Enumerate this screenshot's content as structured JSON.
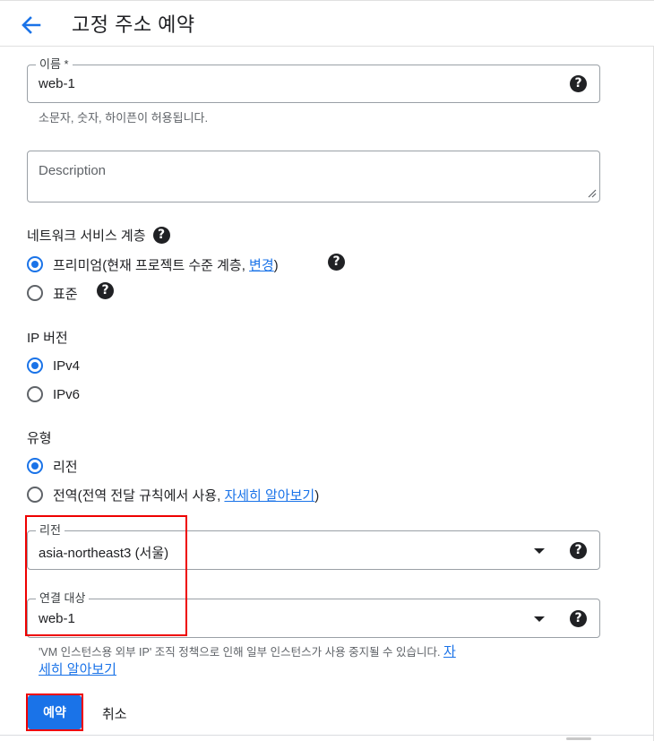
{
  "header": {
    "title": "고정 주소 예약"
  },
  "name_field": {
    "label": "이름 *",
    "value": "web-1",
    "hint": "소문자, 숫자, 하이픈이 허용됩니다."
  },
  "description_field": {
    "placeholder": "Description"
  },
  "network_tier": {
    "title": "네트워크 서비스 계층",
    "options": [
      {
        "label_before": "프리미엄(현재 프로젝트 수준 계층, ",
        "link": "변경",
        "label_after": ")",
        "checked": true
      },
      {
        "label": "표준",
        "checked": false
      }
    ]
  },
  "ip_version": {
    "title": "IP 버전",
    "options": [
      {
        "label": "IPv4",
        "checked": true
      },
      {
        "label": "IPv6",
        "checked": false
      }
    ]
  },
  "type": {
    "title": "유형",
    "options": [
      {
        "label": "리전",
        "checked": true
      },
      {
        "label_before": "전역(전역 전달 규칙에서 사용, ",
        "link": "자세히 알아보기",
        "label_after": ")",
        "checked": false
      }
    ]
  },
  "region_field": {
    "label": "리전",
    "value": "asia-northeast3 (서울)"
  },
  "attach_field": {
    "label": "연결 대상",
    "value": "web-1",
    "hint_line1": "'VM 인스턴스용 외부 IP' 조직 정책으로 인해 일부 인스턴스가 사용 중지될 수 있습니다. ",
    "hint_link_1": "자",
    "hint_link_2": "세히 알아보기"
  },
  "actions": {
    "reserve": "예약",
    "cancel": "취소"
  },
  "icons": {
    "help": "?",
    "back": "arrow-back-icon"
  },
  "colors": {
    "accent": "#1a73e8",
    "highlight": "#ee0000"
  }
}
